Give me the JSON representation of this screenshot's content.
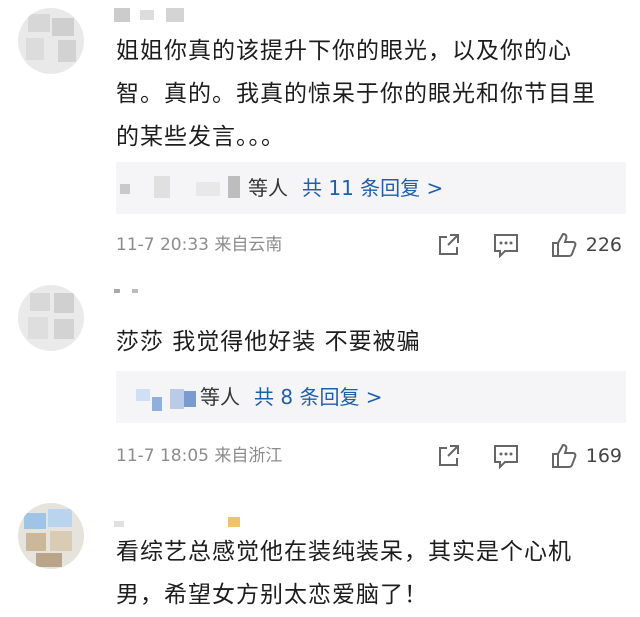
{
  "comments": [
    {
      "text_lines": [
        "姐姐你真的该提升下你的眼光，以及你的心",
        "智。真的。我真的惊呆于你的眼光和你节目里",
        "的某些发言。。。"
      ],
      "reply_visible": "等人",
      "reply_link": "共 11 条回复 >",
      "date": "11-7 20:33",
      "location": "来自云南",
      "likes": "226"
    },
    {
      "text_lines": [
        "莎莎 我觉得他好装 不要被骗"
      ],
      "reply_visible": "等人",
      "reply_link": "共 8 条回复 >",
      "date": "11-7 18:05",
      "location": "来自浙江",
      "likes": "169"
    },
    {
      "text_lines": [
        "看综艺总感觉他在装纯装呆，其实是个心机",
        "男，希望女方别太恋爱脑了！"
      ]
    }
  ],
  "icons": {
    "share": "share-icon",
    "comment": "comment-icon",
    "like": "thumb-up-icon"
  }
}
